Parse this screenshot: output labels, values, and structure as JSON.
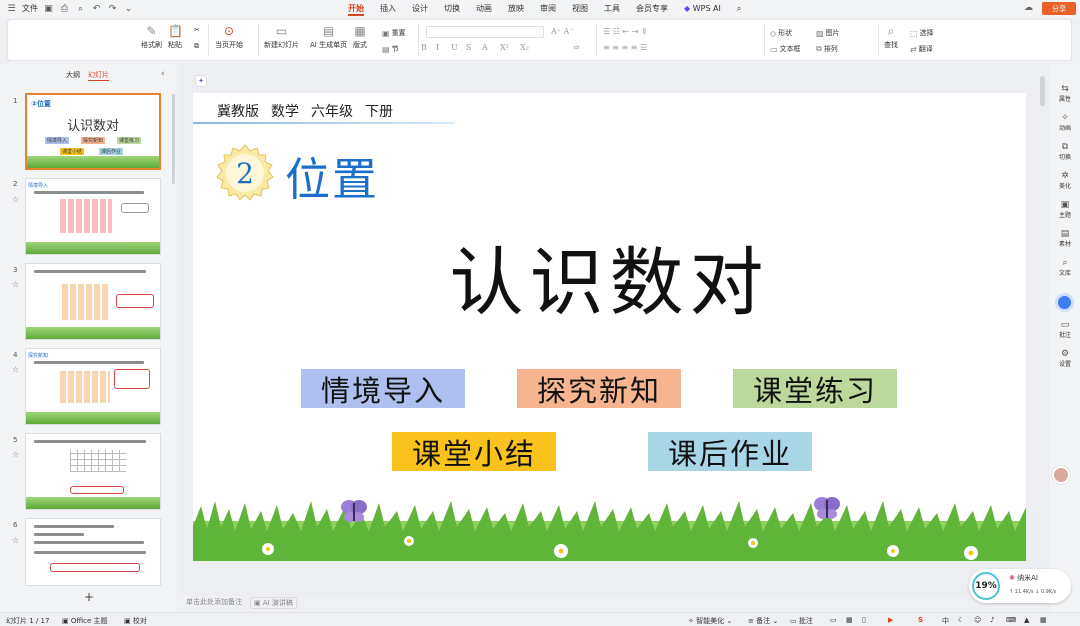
{
  "menubar": {
    "file_label": "文件",
    "tabs": [
      "开始",
      "插入",
      "设计",
      "切换",
      "动画",
      "放映",
      "审阅",
      "视图",
      "工具",
      "会员专享"
    ],
    "active_tab": "开始",
    "wps_ai_label": "WPS AI",
    "share_label": "分享"
  },
  "ribbon": {
    "format_painter": "格式刷",
    "paste": "粘贴",
    "play_current": "当页开始",
    "new_slide": "新建幻灯片",
    "ai_gen_slide": "AI 生成单页",
    "layout": "版式",
    "reset": "重置",
    "section": "节",
    "shape": "形状",
    "image": "图片",
    "textbox": "文本框",
    "arrange": "排列",
    "find": "查找",
    "select": "选择",
    "replace": "翻译",
    "font_format_glyphs": [
      "B",
      "I",
      "U",
      "S",
      "A",
      "X²",
      "X₂",
      "A"
    ]
  },
  "panel": {
    "tab_outline": "大纲",
    "tab_slides": "幻灯片",
    "active_tab": "幻灯片",
    "slide_numbers": [
      "1",
      "2",
      "3",
      "4",
      "5",
      "6"
    ],
    "slide1_title_hint": "位置",
    "slide1_heading": "认识数对",
    "slide1_tags": [
      "情境导入",
      "探究新知",
      "课堂练习",
      "课堂小结",
      "课后作业"
    ],
    "slide2_tag": "情境导入",
    "slide4_tag": "探究新知"
  },
  "slide": {
    "header_items": [
      "冀教版",
      "数学",
      "六年级",
      "下册"
    ],
    "unit_number": "2",
    "unit_title": "位置",
    "main_title": "认识数对",
    "sections": [
      {
        "label": "情境导入",
        "color": "#aebff0"
      },
      {
        "label": "探究新知",
        "color": "#f6b58f"
      },
      {
        "label": "课堂练习",
        "color": "#bcd89a"
      },
      {
        "label": "课堂小结",
        "color": "#fac21c"
      },
      {
        "label": "课后作业",
        "color": "#a7d6e6"
      }
    ]
  },
  "notes": {
    "placeholder": "单击此处添加备注",
    "ai_notes": "AI 演讲稿"
  },
  "sidebar": {
    "items": [
      "属性",
      "动画",
      "切换",
      "美化",
      "主题",
      "素材",
      "文库",
      "批注",
      "设置"
    ]
  },
  "statusbar": {
    "slide_info": "幻灯片 1 / 17",
    "theme": "Office 主题",
    "proofing": "校对",
    "smart_beautify": "智能美化",
    "notes_label": "备注",
    "comments_label": "批注",
    "ime_label": "中"
  },
  "widget": {
    "percent": "19%",
    "label": "纳米AI",
    "upload": "11.4K/s",
    "download": "0.9K/s"
  },
  "colors": {
    "accent": "#d9431e",
    "title_blue": "#1b6fc8",
    "share": "#e8622a"
  }
}
